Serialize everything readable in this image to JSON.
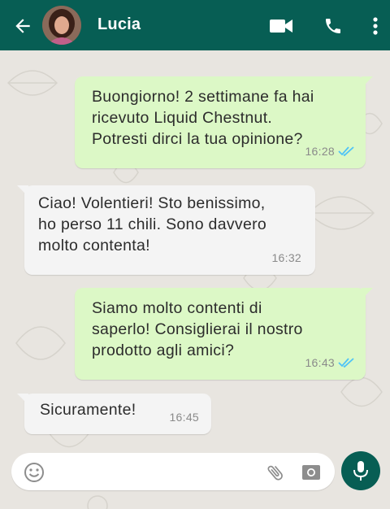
{
  "header": {
    "contact_name": "Lucia",
    "icons": [
      "back-arrow-icon",
      "video-call-icon",
      "phone-icon",
      "more-vert-icon"
    ]
  },
  "messages": [
    {
      "direction": "out",
      "text": "Buongiorno! 2 settimane fa hai\nricevuto Liquid Chestnut.\nPotresti dirci la tua opinione?",
      "time": "16:28",
      "read": true
    },
    {
      "direction": "in",
      "text": "Ciao! Volentieri! Sto benissimo,\nho perso 11 chili. Sono davvero\nmolto contenta!",
      "time": "16:32"
    },
    {
      "direction": "out",
      "text": "Siamo molto contenti di\nsaperlo! Consiglierai il nostro\nprodotto agli amici?",
      "time": "16:43",
      "read": true
    },
    {
      "direction": "in",
      "text": "Sicuramente!",
      "time": "16:45"
    }
  ],
  "composer": {
    "value": "",
    "icons": [
      "emoji-icon",
      "attach-icon",
      "camera-icon",
      "mic-icon"
    ]
  },
  "colors": {
    "header": "#075e54",
    "outgoing_bubble": "#dcf8c6",
    "incoming_bubble": "#f4f4f4",
    "read_ticks": "#4fc3f7",
    "chat_background": "#e8e5e0"
  }
}
